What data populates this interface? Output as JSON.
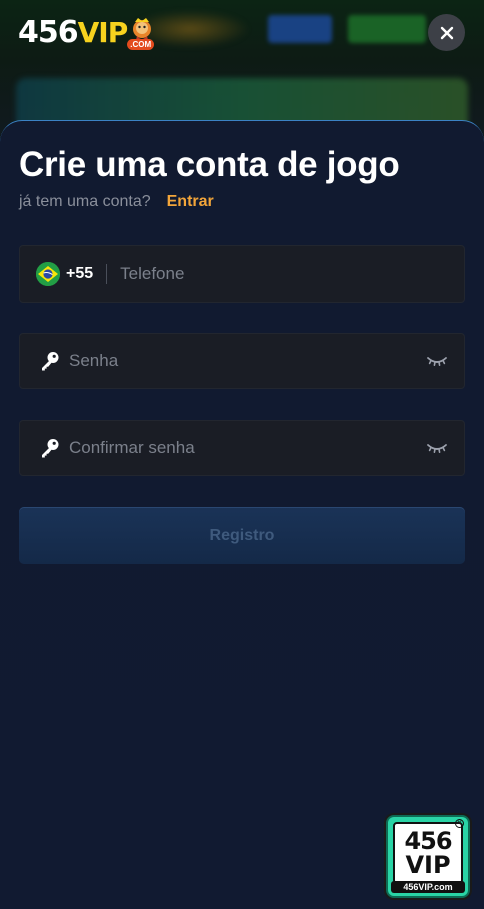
{
  "header": {
    "logo_number": "456",
    "logo_vip": "VIP",
    "logo_com": ".COM"
  },
  "modal": {
    "title": "Crie uma conta de jogo",
    "subtitle": "já tem uma conta?",
    "login_link": "Entrar",
    "phone": {
      "country_code": "+55",
      "placeholder": "Telefone",
      "flag_icon": "brazil-flag-icon"
    },
    "password": {
      "placeholder": "Senha"
    },
    "confirm_password": {
      "placeholder": "Confirmar senha"
    },
    "register_label": "Registro"
  },
  "badge": {
    "number": "456",
    "vip": "VIP",
    "url": "456VIP.com",
    "reg_mark": "R"
  },
  "colors": {
    "accent_link": "#f2a53a",
    "modal_bg": "#111a30",
    "field_bg": "#1a1d25",
    "register_bg": "#1a3357"
  }
}
